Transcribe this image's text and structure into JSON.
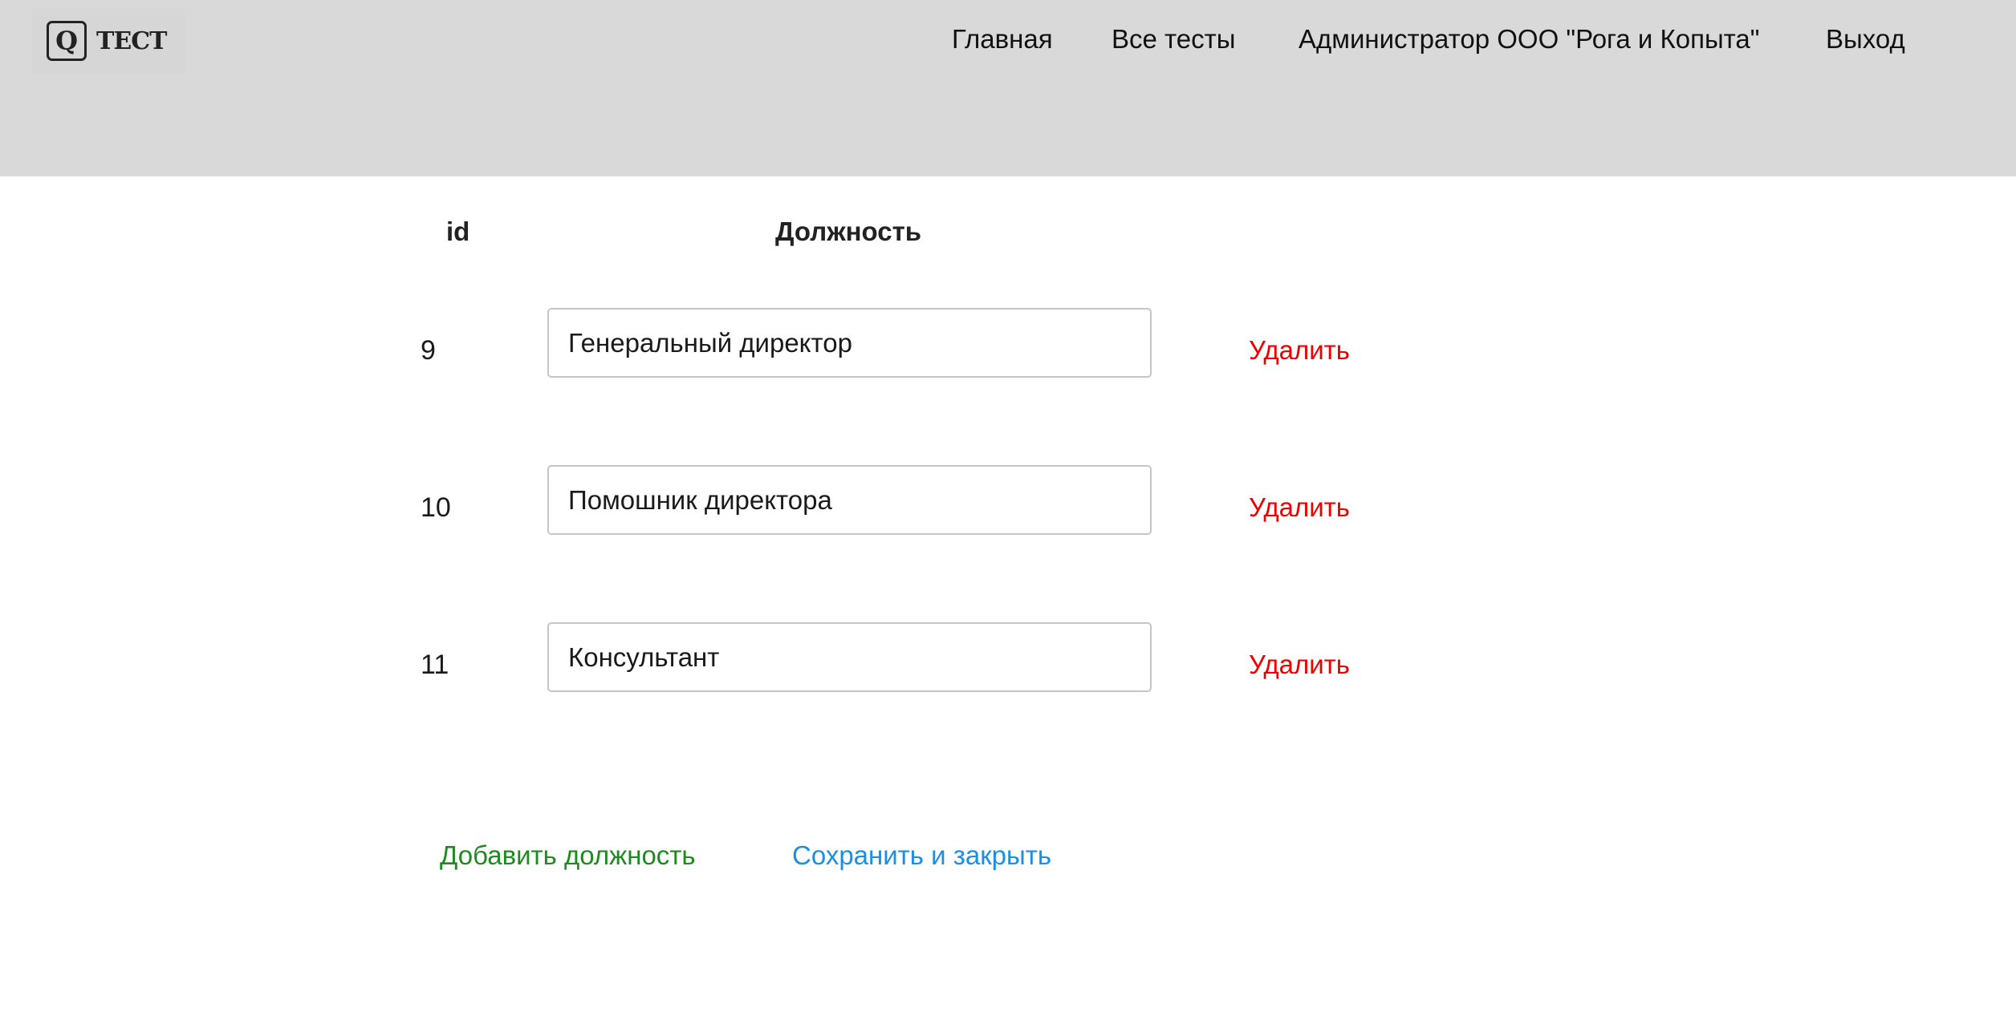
{
  "header": {
    "logo_letter": "Q",
    "logo_text": "ТЕСТ",
    "nav": {
      "home": "Главная",
      "all_tests": "Все тесты",
      "user": "Администратор ООО \"Рога и Копыта\"",
      "logout": "Выход"
    }
  },
  "table": {
    "col_id": "id",
    "col_position": "Должность",
    "rows": [
      {
        "id": "9",
        "position": "Генеральный директор",
        "delete_label": "Удалить"
      },
      {
        "id": "10",
        "position": "Помошник директора",
        "delete_label": "Удалить"
      },
      {
        "id": "11",
        "position": "Консультант",
        "delete_label": "Удалить"
      }
    ]
  },
  "actions": {
    "add": "Добавить должность",
    "save": "Сохранить и закрыть"
  },
  "colors": {
    "header_bg": "#d9d9d9",
    "delete": "#ee0000",
    "add": "#1f8a1f",
    "save": "#1a8fe3"
  }
}
